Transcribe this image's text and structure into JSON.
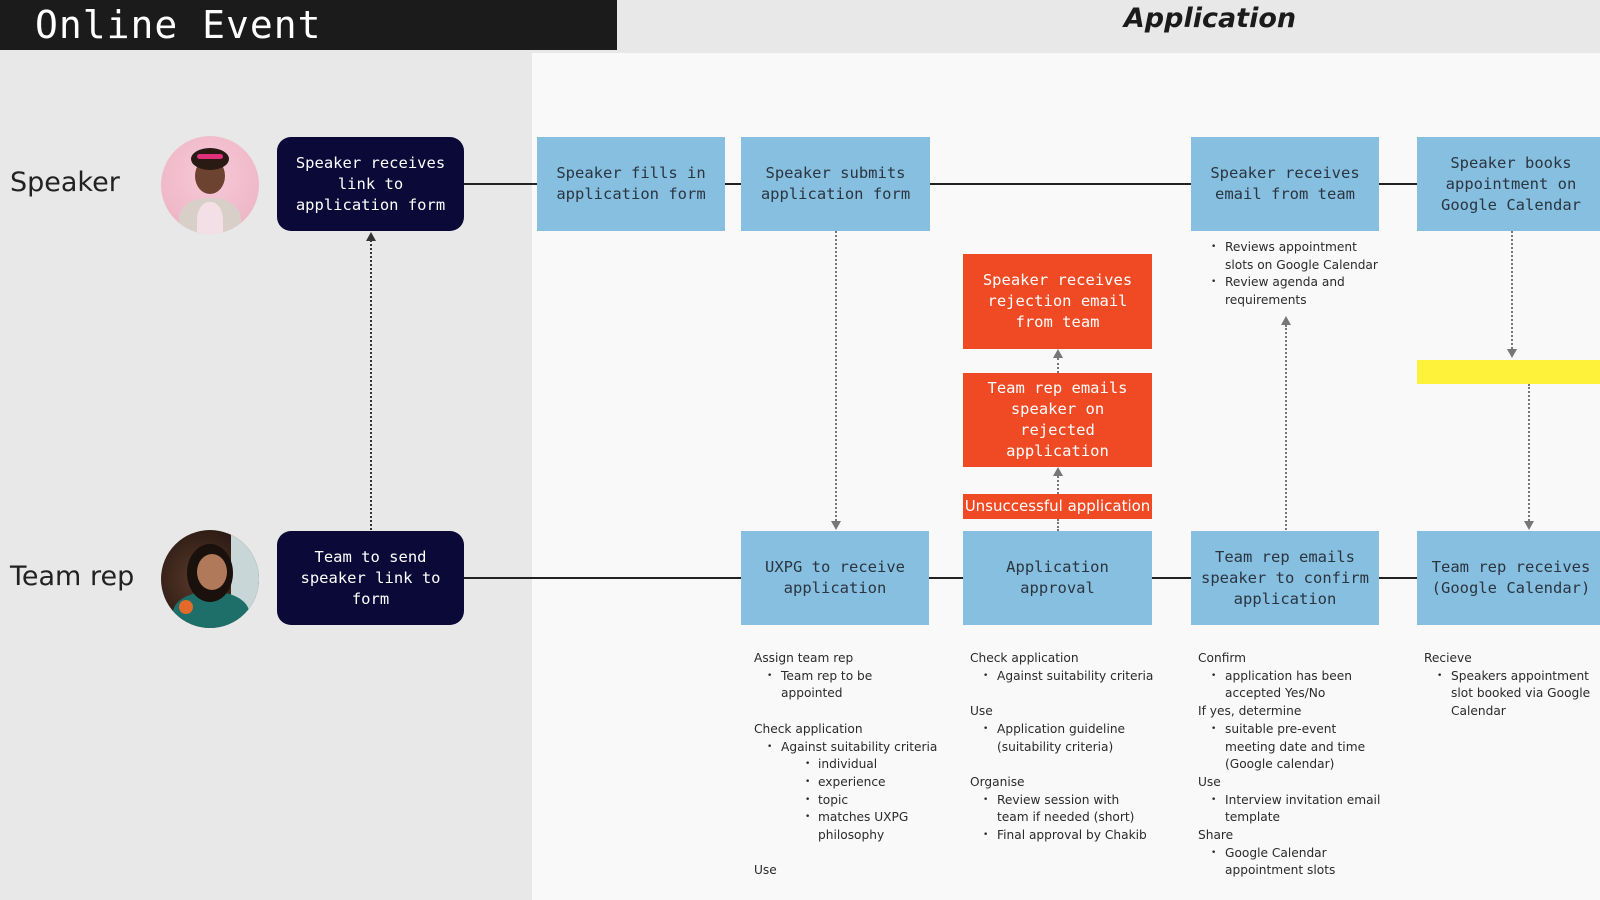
{
  "header": {
    "title": "Online Event",
    "phase": "Application"
  },
  "lanes": [
    {
      "label": "Speaker",
      "avatar": "speaker-avatar"
    },
    {
      "label": "Team rep",
      "avatar": "team-rep-avatar"
    }
  ],
  "colors": {
    "dark_box": "#0a0938",
    "blue_box": "#87bfe0",
    "red_box": "#f04a25",
    "yellow_box": "#fff23a",
    "header_bg": "#1b1b1b"
  },
  "speaker_steps": {
    "receives_link": "Speaker receives link to application form",
    "fills_in": "Speaker fills in application form",
    "submits": "Speaker submits application form",
    "receives_email": "Speaker receives email from team",
    "books": "Speaker books appointment on Google Calendar"
  },
  "rejection": {
    "speaker_rejection": "Speaker receives rejection email from team",
    "team_emails_rejected": "Team rep emails speaker on rejected application",
    "unsuccessful": "Unsuccessful application"
  },
  "team_steps": {
    "send_link": "Team to send speaker link to form",
    "uxpg_receive": "UXPG to receive application",
    "approval": "Application approval",
    "confirm": "Team rep emails speaker to confirm application",
    "receives_calendar": "Team rep receives (Google Calendar)"
  },
  "notes": {
    "speaker_email": {
      "bullets": [
        "Reviews appointment slots on Google Calendar",
        "Review agenda and requirements"
      ]
    },
    "uxpg": {
      "assign_head": "Assign team rep",
      "assign_bullet": "Team rep to be appointed",
      "check_head": "Check application",
      "check_bullet": "Against suitability criteria",
      "criteria": [
        "individual",
        "experience",
        "topic",
        "matches UXPG philosophy"
      ],
      "use_head": "Use"
    },
    "approval": {
      "check_head": "Check application",
      "check_bullet": "Against suitability criteria",
      "use_head": "Use",
      "use_bullet": "Application guideline (suitability criteria)",
      "organise_head": "Organise",
      "organise_bullets": [
        "Review session with team if needed (short)",
        "Final approval by Chakib"
      ]
    },
    "confirm": {
      "confirm_head": "Confirm",
      "confirm_bullet": "application has been accepted Yes/No",
      "ifyes_head": "If yes, determine",
      "ifyes_bullet": "suitable pre-event meeting date and time (Google calendar)",
      "use_head": "Use",
      "use_bullet": "Interview invitation email template",
      "share_head": "Share",
      "share_bullet": "Google Calendar appointment slots"
    },
    "receive": {
      "head": "Recieve",
      "bullet": "Speakers appointment slot booked via Google Calendar"
    }
  }
}
